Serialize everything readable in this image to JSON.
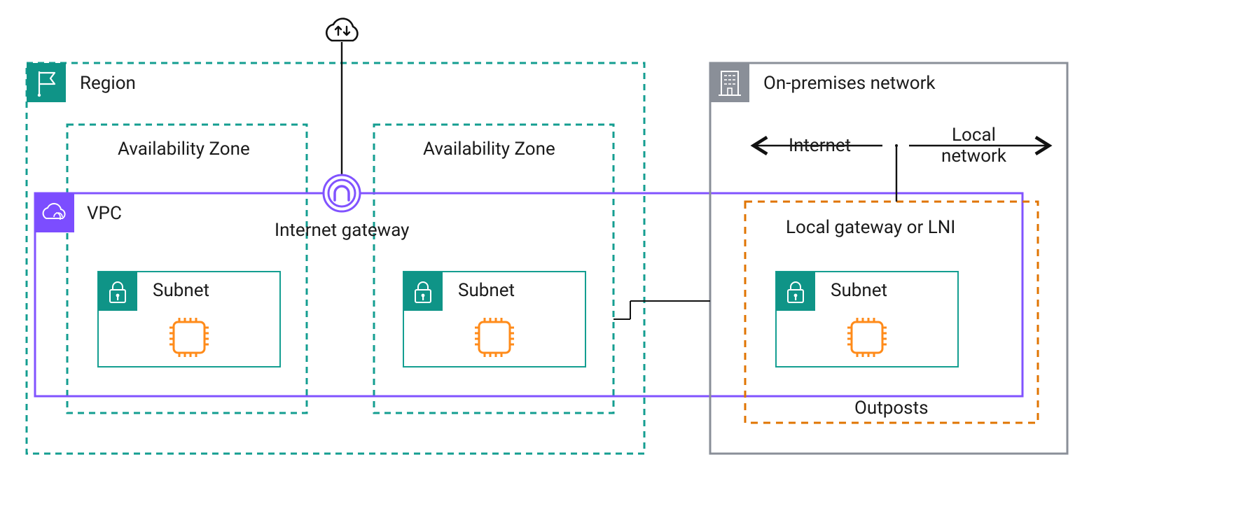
{
  "colors": {
    "teal": "#149e91",
    "tealFill": "#0f9487",
    "purple": "#7c4dff",
    "purpleStroke": "#8153ff",
    "orange": "#e07400",
    "orangeIcon": "#ff8b1a",
    "gray": "#8a8f98",
    "black": "#111111"
  },
  "region": {
    "label": "Region"
  },
  "az": {
    "label1": "Availability Zone",
    "label2": "Availability Zone"
  },
  "vpc": {
    "label": "VPC"
  },
  "subnet": {
    "label1": "Subnet",
    "label2": "Subnet",
    "label3": "Subnet"
  },
  "igw": {
    "label": "Internet gateway"
  },
  "onprem": {
    "label": "On-premises network",
    "internet": "Internet",
    "localnet": "Local\nnetwork"
  },
  "lgw": {
    "label": "Local gateway or LNI"
  },
  "outposts": {
    "label": "Outposts"
  }
}
